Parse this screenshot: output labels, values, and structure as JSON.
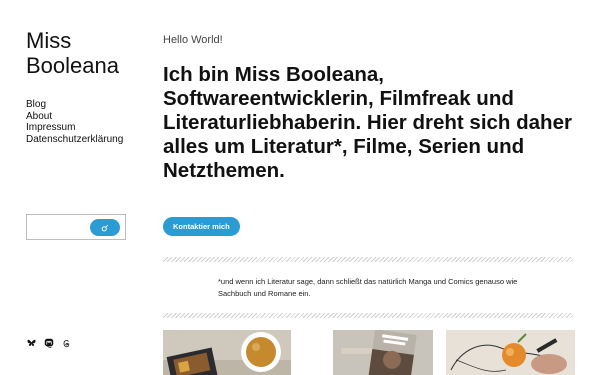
{
  "site": {
    "title": "Miss Booleana"
  },
  "nav": {
    "items": [
      {
        "label": "Blog"
      },
      {
        "label": "About"
      },
      {
        "label": "Impressum"
      },
      {
        "label": "Datenschutzerklärung"
      }
    ]
  },
  "search": {
    "value": "",
    "placeholder": ""
  },
  "social": {
    "icons": [
      "bluesky-icon",
      "mastodon-icon",
      "threads-icon"
    ]
  },
  "main": {
    "greeting": "Hello World!",
    "headline": "Ich bin Miss Booleana, Softwareentwicklerin, Filmfreak und Literaturliebhaberin. Hier dreht sich daher alles um Literatur*, Filme, Serien und Netzthemen.",
    "cta_label": "Kontaktier mich",
    "footnote": "*und wenn ich Literatur sage, dann schließt das natürlich Manga und Comics genauso wie Sachbuch und Romane ein."
  },
  "colors": {
    "accent": "#2a9bd3"
  }
}
